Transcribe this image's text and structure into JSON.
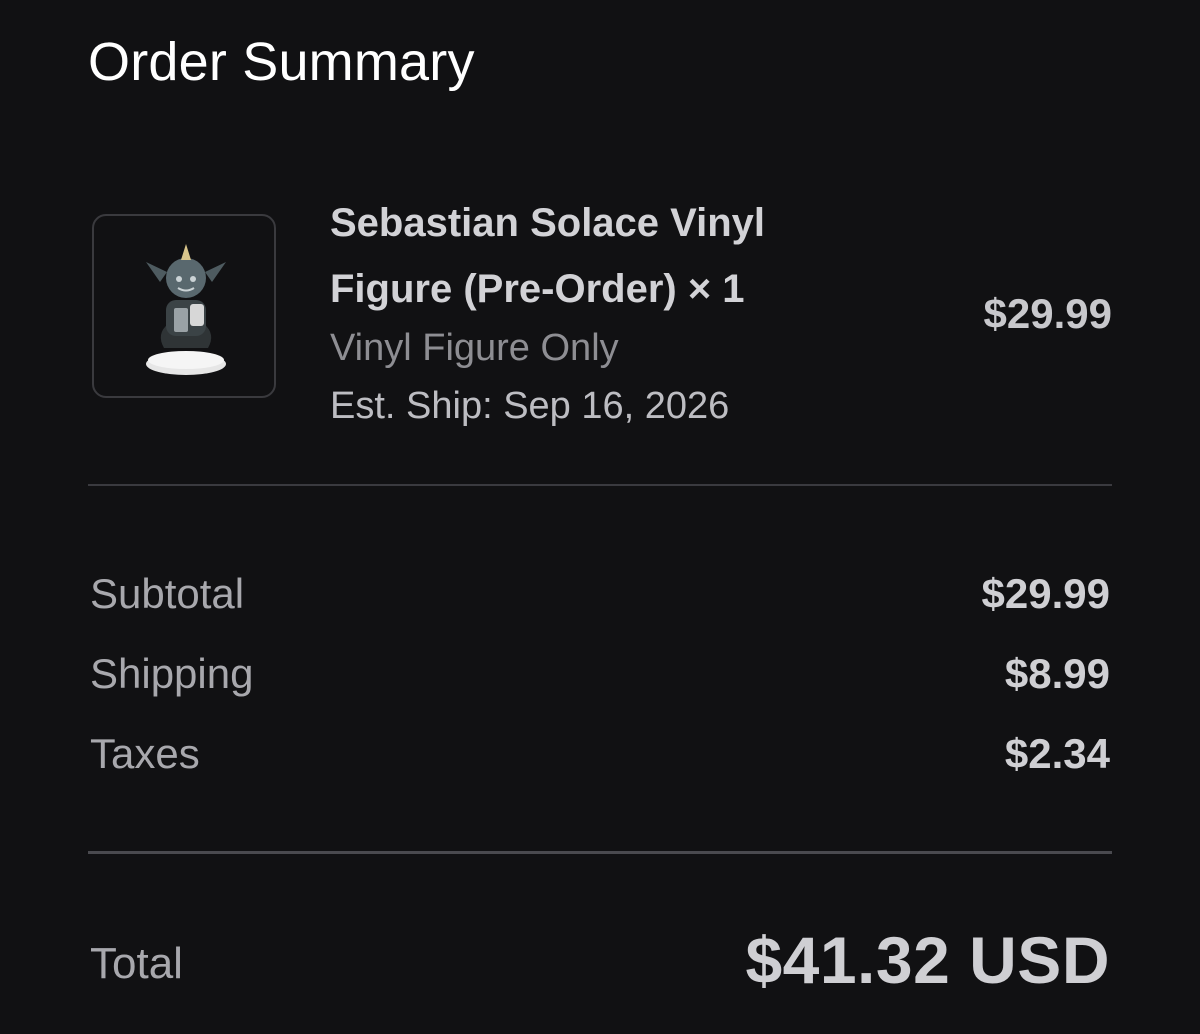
{
  "header": {
    "title": "Order Summary"
  },
  "item": {
    "image_icon": "vinyl-figure-thumbnail",
    "title": "Sebastian Solace Vinyl Figure (Pre-Order) × 1",
    "variant": "Vinyl Figure Only",
    "ship": "Est. Ship: Sep 16, 2026",
    "price": "$29.99"
  },
  "summary": {
    "subtotal_label": "Subtotal",
    "subtotal_value": "$29.99",
    "shipping_label": "Shipping",
    "shipping_value": "$8.99",
    "taxes_label": "Taxes",
    "taxes_value": "$2.34"
  },
  "total": {
    "label": "Total",
    "value": "$41.32 USD"
  },
  "colors": {
    "background": "#111113",
    "text_primary": "#ffffff",
    "text_secondary": "#8e8e93",
    "divider": "#3a3a3f"
  }
}
